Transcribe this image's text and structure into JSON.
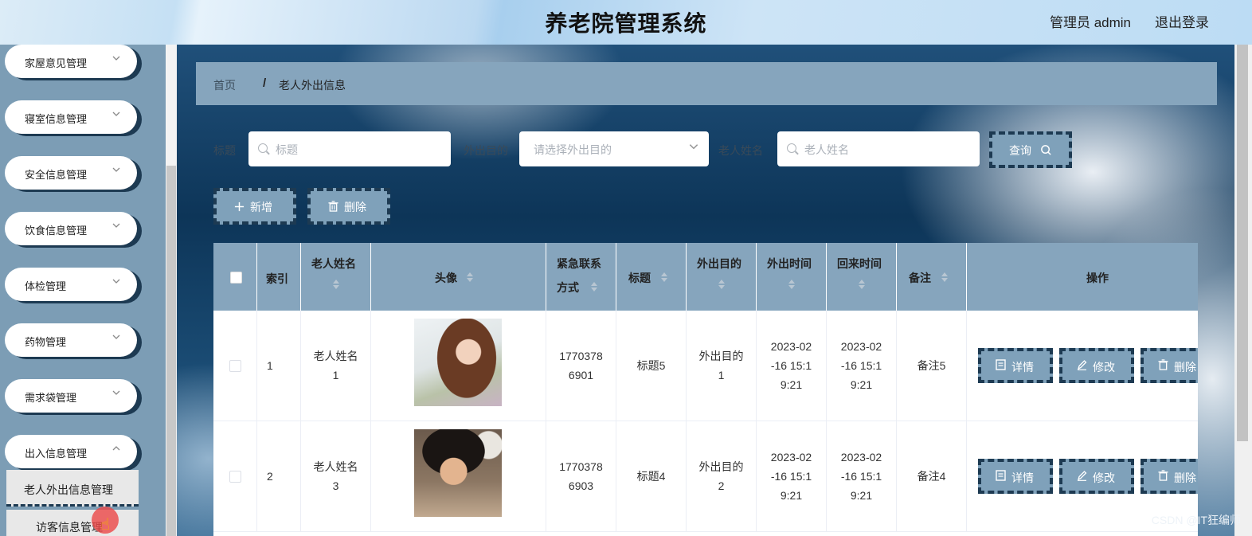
{
  "header": {
    "title": "养老院管理系统",
    "user": "管理员 admin",
    "logout": "退出登录"
  },
  "sidebar": {
    "menu": [
      {
        "label": "家屋意见管理"
      },
      {
        "label": "寝室信息管理"
      },
      {
        "label": "安全信息管理"
      },
      {
        "label": "饮食信息管理"
      },
      {
        "label": "体检管理"
      },
      {
        "label": "药物管理"
      },
      {
        "label": "需求袋管理"
      },
      {
        "label": "出入信息管理"
      }
    ],
    "submenu_active": "老人外出信息管理",
    "submenu_next": "访客信息管理"
  },
  "breadcrumb": {
    "home": "首页",
    "separator": "/",
    "current": "老人外出信息"
  },
  "filters": {
    "title_label": "标题",
    "title_placeholder": "标题",
    "purpose_label": "外出目的",
    "purpose_placeholder": "请选择外出目的",
    "name_label": "老人姓名",
    "name_placeholder": "老人姓名",
    "search_button": "查询"
  },
  "actions": {
    "add": "新增",
    "delete": "删除"
  },
  "table": {
    "columns": {
      "index": "索引",
      "name": "老人姓名",
      "avatar": "头像",
      "contact_line1": "紧急联系",
      "contact_line2": "方式",
      "title": "标题",
      "purpose": "外出目的",
      "out_time": "外出时间",
      "return_time": "回来时间",
      "remark": "备注",
      "ops": "操作"
    },
    "rows": [
      {
        "index": "1",
        "name_line1": "老人姓名",
        "name_line2": "1",
        "contact_line1": "1770378",
        "contact_line2": "6901",
        "title": "标题5",
        "purpose_line1": "外出目的",
        "purpose_line2": "1",
        "out_line1": "2023-02",
        "out_line2": "-16 15:1",
        "out_line3": "9:21",
        "ret_line1": "2023-02",
        "ret_line2": "-16 15:1",
        "ret_line3": "9:21",
        "remark": "备注5"
      },
      {
        "index": "2",
        "name_line1": "老人姓名",
        "name_line2": "3",
        "contact_line1": "1770378",
        "contact_line2": "6903",
        "title": "标题4",
        "purpose_line1": "外出目的",
        "purpose_line2": "2",
        "out_line1": "2023-02",
        "out_line2": "-16 15:1",
        "out_line3": "9:21",
        "ret_line1": "2023-02",
        "ret_line2": "-16 15:1",
        "ret_line3": "9:21",
        "remark": "备注4"
      }
    ],
    "row_buttons": {
      "detail": "详情",
      "edit": "修改",
      "delete": "删除"
    }
  },
  "watermark": "CSDN @IT狂编师",
  "icons": {
    "chevron": "chevron-down-icon",
    "search": "search-icon",
    "plus": "plus-icon",
    "trash": "trash-icon",
    "doc": "document-icon",
    "pencil": "pencil-icon",
    "cursor": "hand-cursor-icon"
  },
  "colors": {
    "accent": "#7fa1ba",
    "dash_border": "#1d3a52",
    "header_bar": "#86a5bd"
  }
}
